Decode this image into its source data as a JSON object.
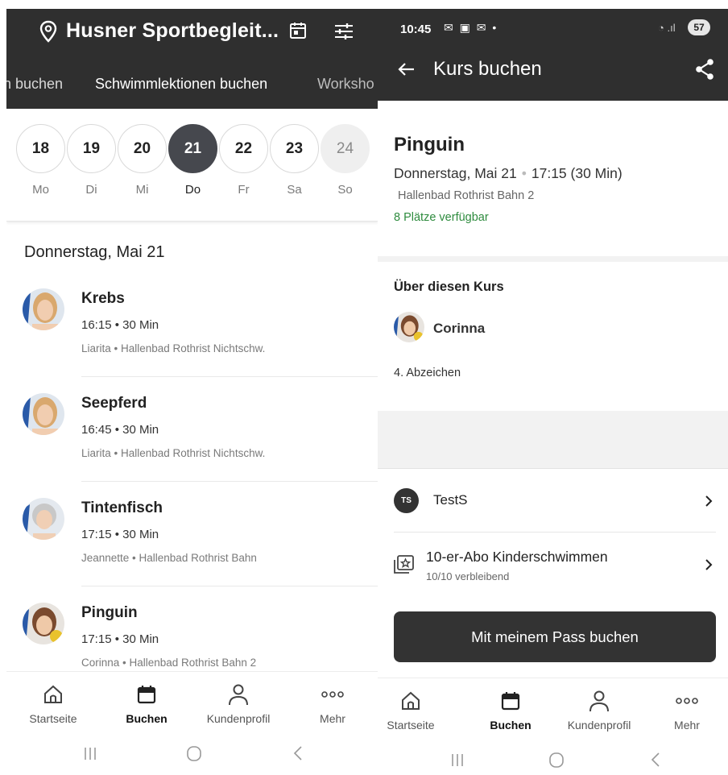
{
  "left": {
    "header": {
      "title": "Husner Sportbegleit..."
    },
    "tabs": [
      "n buchen",
      "Schwimmlektionen buchen",
      "Worksho"
    ],
    "days": [
      {
        "num": "18",
        "wd": "Mo"
      },
      {
        "num": "19",
        "wd": "Di"
      },
      {
        "num": "20",
        "wd": "Mi"
      },
      {
        "num": "21",
        "wd": "Do"
      },
      {
        "num": "22",
        "wd": "Fr"
      },
      {
        "num": "23",
        "wd": "Sa"
      },
      {
        "num": "24",
        "wd": "So"
      }
    ],
    "selected_day": "21",
    "date_heading": "Donnerstag, Mai 21",
    "classes": [
      {
        "name": "Krebs",
        "time": "16:15 • 30 Min",
        "loc": "Liarita  • Hallenbad Rothrist Nichtschw."
      },
      {
        "name": "Seepferd",
        "time": "16:45 • 30 Min",
        "loc": "Liarita  • Hallenbad Rothrist Nichtschw."
      },
      {
        "name": "Tintenfisch",
        "time": "17:15 • 30 Min",
        "loc": "Jeannette  • Hallenbad Rothrist Bahn"
      },
      {
        "name": "Pinguin",
        "time": "17:15 • 30 Min",
        "loc": "Corinna  • Hallenbad Rothrist Bahn 2"
      }
    ],
    "nav": [
      "Startseite",
      "Buchen",
      "Kundenprofil",
      "Mehr"
    ]
  },
  "right": {
    "status": {
      "time": "10:45",
      "battery": "57"
    },
    "header": {
      "title": "Kurs buchen"
    },
    "course": {
      "name": "Pinguin",
      "date": "Donnerstag, Mai 21",
      "time": "17:15 (30 Min)",
      "location": "Hallenbad Rothrist Bahn 2",
      "availability": "8 Plätze verfügbar"
    },
    "about": {
      "heading": "Über diesen Kurs",
      "instructor": "Corinna",
      "description": "4. Abzeichen"
    },
    "user": {
      "initials": "TS",
      "name": "TestS"
    },
    "pass": {
      "name": "10-er-Abo Kinderschwimmen",
      "remaining": "10/10 verbleibend"
    },
    "book_button": "Mit meinem Pass buchen",
    "nav": [
      "Startseite",
      "Buchen",
      "Kundenprofil",
      "Mehr"
    ]
  },
  "colors": {
    "header_bg": "#2f2f2f",
    "selected_day": "#46484e",
    "available_green": "#2e8b3e",
    "button_bg": "#333333"
  }
}
